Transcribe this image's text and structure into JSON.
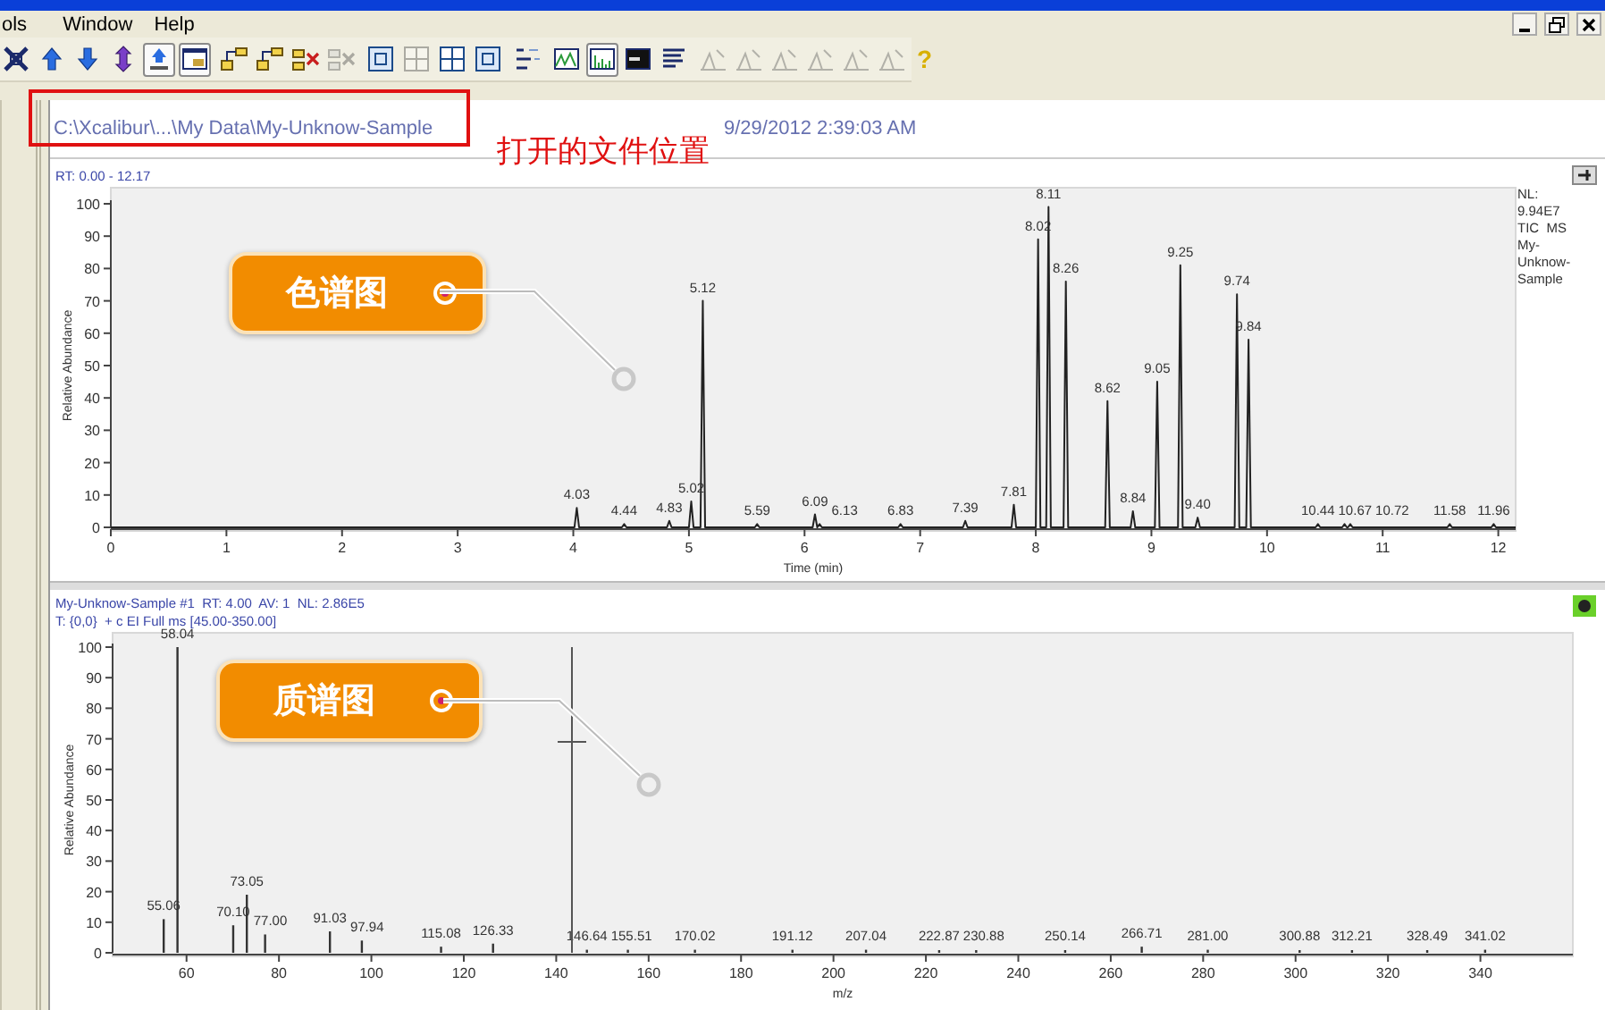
{
  "menu": [
    {
      "label": "ols"
    },
    {
      "label": "Window"
    },
    {
      "label": "Help"
    }
  ],
  "toolbar": [
    [
      {
        "kind": "expand",
        "disabled": false,
        "pressed": false
      },
      {
        "kind": "arrow-up",
        "disabled": false,
        "pressed": false
      },
      {
        "kind": "arrow-down",
        "disabled": false,
        "pressed": false
      },
      {
        "kind": "arrow-both",
        "disabled": false,
        "pressed": false
      },
      {
        "kind": "arrow-box",
        "disabled": false,
        "pressed": true
      },
      {
        "kind": "window",
        "disabled": false,
        "pressed": true
      }
    ],
    [
      {
        "kind": "tree",
        "disabled": false,
        "pressed": false
      },
      {
        "kind": "tree",
        "disabled": false,
        "pressed": false
      },
      {
        "kind": "tree-remove",
        "disabled": false,
        "pressed": false
      },
      {
        "kind": "tree-remove",
        "disabled": true,
        "pressed": false
      }
    ],
    [
      {
        "kind": "fit",
        "disabled": false,
        "pressed": false
      },
      {
        "kind": "grid",
        "disabled": true,
        "pressed": false
      },
      {
        "kind": "grid",
        "disabled": false,
        "pressed": false
      },
      {
        "kind": "fit",
        "disabled": false,
        "pressed": false
      }
    ],
    [
      {
        "kind": "legend",
        "disabled": false,
        "pressed": false
      }
    ],
    [
      {
        "kind": "peaks",
        "disabled": false,
        "pressed": false
      },
      {
        "kind": "spectrum",
        "disabled": false,
        "pressed": true
      },
      {
        "kind": "screen",
        "disabled": false,
        "pressed": false
      },
      {
        "kind": "lines",
        "disabled": false,
        "pressed": false
      }
    ],
    [
      {
        "kind": "peak-tool",
        "disabled": true,
        "pressed": false
      },
      {
        "kind": "peak-tool",
        "disabled": true,
        "pressed": false
      },
      {
        "kind": "peak-tool",
        "disabled": true,
        "pressed": false
      },
      {
        "kind": "peak-tool",
        "disabled": true,
        "pressed": false
      },
      {
        "kind": "peak-tool",
        "disabled": true,
        "pressed": false
      },
      {
        "kind": "peak-tool",
        "disabled": true,
        "pressed": false
      }
    ],
    [
      {
        "kind": "help",
        "glyph": "?",
        "disabled": false,
        "pressed": false
      }
    ]
  ],
  "file": {
    "path": "C:\\Xcalibur\\...\\My Data\\My-Unknow-Sample",
    "date": "9/29/2012 2:39:03 AM",
    "note": "打开的文件位置"
  },
  "chromatogram": {
    "range": "RT: 0.00 - 12.17",
    "info": [
      "NL:",
      "9.94E7",
      "TIC  MS",
      "My-",
      "Unknow-",
      "Sample"
    ],
    "callout": "色谱图",
    "chart_data": {
      "type": "line",
      "xlabel": "Time (min)",
      "ylabel": "Relative Abundance",
      "xlim": [
        0,
        12.15
      ],
      "ylim": [
        0,
        100
      ],
      "xticks": [
        0,
        1,
        2,
        3,
        4,
        5,
        6,
        7,
        8,
        9,
        10,
        11,
        12
      ],
      "yticks": [
        0,
        10,
        20,
        30,
        40,
        50,
        60,
        70,
        80,
        90,
        100
      ],
      "x": [
        0,
        4.01,
        4.03,
        4.05,
        4.42,
        4.44,
        4.46,
        4.81,
        4.83,
        4.85,
        5.0,
        5.02,
        5.04,
        5.1,
        5.12,
        5.14,
        5.57,
        5.59,
        5.61,
        6.07,
        6.09,
        6.11,
        6.13,
        6.15,
        6.81,
        6.83,
        6.85,
        7.37,
        7.39,
        7.41,
        7.79,
        7.81,
        7.83,
        8.0,
        8.02,
        8.04,
        8.09,
        8.11,
        8.13,
        8.24,
        8.26,
        8.28,
        8.6,
        8.62,
        8.64,
        8.82,
        8.84,
        8.86,
        9.03,
        9.05,
        9.07,
        9.23,
        9.25,
        9.27,
        9.38,
        9.4,
        9.42,
        9.72,
        9.74,
        9.76,
        9.82,
        9.84,
        9.86,
        10.42,
        10.44,
        10.46,
        10.65,
        10.67,
        10.69,
        10.7,
        10.72,
        10.74,
        11.56,
        11.58,
        11.6,
        11.94,
        11.96,
        11.98,
        12.15
      ],
      "series": [
        {
          "color": "#222222",
          "values": [
            0,
            0,
            6,
            0,
            0,
            1,
            0,
            0,
            2,
            0,
            0,
            8,
            0,
            0,
            70,
            0,
            0,
            1,
            0,
            0,
            4,
            0,
            1,
            0,
            0,
            1,
            0,
            0,
            2,
            0,
            0,
            7,
            0,
            0,
            89,
            0,
            0,
            99,
            0,
            0,
            76,
            0,
            0,
            39,
            0,
            0,
            5,
            0,
            0,
            45,
            0,
            0,
            81,
            0,
            0,
            3,
            0,
            0,
            72,
            0,
            0,
            58,
            0,
            0,
            1,
            0,
            0,
            1,
            0,
            0,
            1,
            0,
            0,
            1,
            0,
            0,
            1,
            0,
            0
          ]
        }
      ],
      "value_labels": [
        null,
        null,
        "4.03",
        null,
        null,
        "4.44",
        null,
        null,
        "4.83",
        null,
        null,
        "5.02",
        null,
        null,
        "5.12",
        null,
        null,
        "5.59",
        null,
        null,
        "6.09",
        null,
        "6.13",
        null,
        null,
        "6.83",
        null,
        null,
        "7.39",
        null,
        null,
        "7.81",
        null,
        null,
        "8.02",
        null,
        null,
        "8.11",
        null,
        null,
        "8.26",
        null,
        null,
        "8.62",
        null,
        null,
        "8.84",
        null,
        null,
        "9.05",
        null,
        null,
        "9.25",
        null,
        null,
        "9.40",
        null,
        null,
        "9.74",
        null,
        null,
        "9.84",
        null,
        null,
        "10.44",
        null,
        null,
        "10.67",
        null,
        null,
        "10.72",
        null,
        null,
        "11.58",
        null,
        null,
        "11.96",
        null,
        null
      ]
    }
  },
  "spectrum": {
    "header": [
      "My-Unknow-Sample #1  RT: 4.00  AV: 1  NL: 2.86E5",
      "T: {0,0}  + c EI Full ms [45.00-350.00]"
    ],
    "callout": "质谱图",
    "chart_data": {
      "type": "bar",
      "xlabel": "m/z",
      "ylabel": "Relative Abundance",
      "xlim": [
        44,
        360
      ],
      "ylim": [
        0,
        100
      ],
      "xticks": [
        60,
        80,
        100,
        120,
        140,
        160,
        180,
        200,
        220,
        240,
        260,
        280,
        300,
        320,
        340
      ],
      "yticks": [
        0,
        10,
        20,
        30,
        40,
        50,
        60,
        70,
        80,
        90,
        100
      ],
      "x": [
        55.06,
        58.04,
        70.1,
        73.05,
        77.0,
        91.03,
        97.94,
        115.08,
        126.33,
        146.64,
        155.51,
        170.02,
        191.12,
        207.04,
        222.87,
        230.88,
        250.14,
        266.71,
        281.0,
        300.88,
        312.21,
        328.49,
        341.02
      ],
      "series": [
        {
          "color": "#333333",
          "values": [
            11,
            100,
            9,
            19,
            6,
            7,
            4,
            2,
            3,
            1,
            1,
            1,
            1,
            1,
            0.5,
            0.5,
            0.5,
            2,
            1,
            0.5,
            0.5,
            0.5,
            1
          ]
        }
      ],
      "value_labels": [
        "55.06",
        "58.04",
        "70.10",
        "73.05",
        "77.00",
        "91.03",
        "97.94",
        "115.08",
        "126.33",
        "146.64",
        "155.51",
        "170.02",
        "191.12",
        "207.04",
        "222.87",
        "230.88",
        "250.14",
        "266.71",
        "281.00",
        "300.88",
        "312.21",
        "328.49",
        "341.02"
      ]
    }
  }
}
